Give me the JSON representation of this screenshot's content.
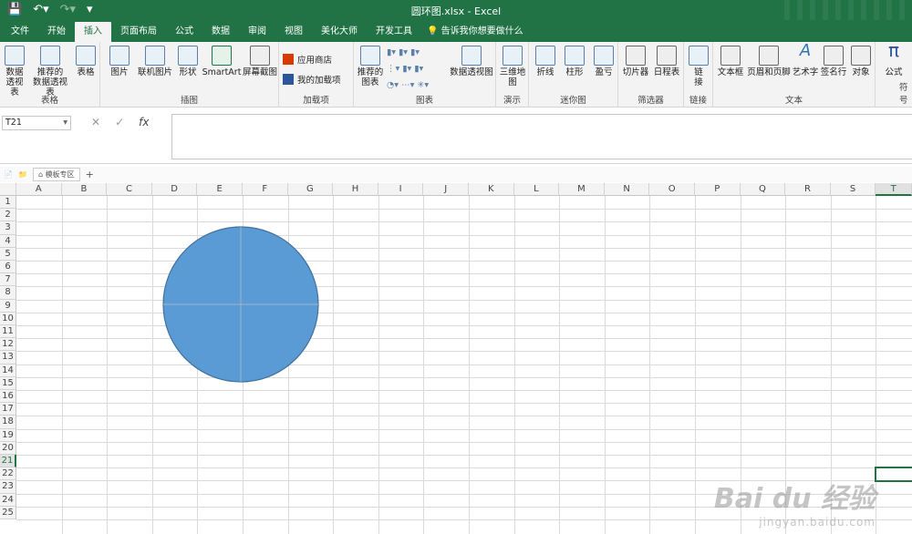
{
  "window": {
    "title": "圆环图.xlsx  -  Excel"
  },
  "qat": {
    "save_icon": "save-icon",
    "undo_icon": "undo-icon",
    "redo_icon": "redo-icon"
  },
  "tabs": [
    {
      "label": "文件"
    },
    {
      "label": "开始"
    },
    {
      "label": "插入"
    },
    {
      "label": "页面布局"
    },
    {
      "label": "公式"
    },
    {
      "label": "数据"
    },
    {
      "label": "审阅"
    },
    {
      "label": "视图"
    },
    {
      "label": "美化大师"
    },
    {
      "label": "开发工具"
    }
  ],
  "active_tab": "插入",
  "tell_me": "告诉我你想要做什么",
  "ribbon": {
    "groups": {
      "tables": "表格",
      "illustrations": "插图",
      "addins": "加载项",
      "charts": "图表",
      "tours": "演示",
      "sparklines": "迷你图",
      "filters": "筛选器",
      "links": "链接",
      "text": "文本",
      "symbols": "符号"
    },
    "buttons": {
      "pivot": "数据\n透视表",
      "recommended_pivot": "推荐的\n数据透视表",
      "table": "表格",
      "picture": "图片",
      "online_picture": "联机图片",
      "shapes": "形状",
      "smartart": "SmartArt",
      "screenshot": "屏幕截图",
      "store": "应用商店",
      "my_addins": "我的加载项",
      "recommended_charts": "推荐的\n图表",
      "pivot_chart": "数据透视图",
      "map3d": "三维地\n图",
      "line": "折线",
      "column": "柱形",
      "winloss": "盈亏",
      "slicer": "切片器",
      "timeline": "日程表",
      "hyperlink": "链\n接",
      "textbox": "文本框",
      "header_footer": "页眉和页脚",
      "wordart": "艺术字",
      "signature": "签名行",
      "object": "对象",
      "equation": "公式"
    }
  },
  "formula_bar": {
    "name_box": "T21",
    "fx": "fx",
    "value": ""
  },
  "sheet_tab": "模板专区",
  "columns": [
    "A",
    "B",
    "C",
    "D",
    "E",
    "F",
    "G",
    "H",
    "I",
    "J",
    "K",
    "L",
    "M",
    "N",
    "O",
    "P",
    "Q",
    "R",
    "S",
    "T"
  ],
  "rows": [
    "1",
    "2",
    "3",
    "4",
    "5",
    "6",
    "7",
    "8",
    "9",
    "10",
    "11",
    "12",
    "13",
    "14",
    "15",
    "16",
    "17",
    "18",
    "19",
    "20",
    "21",
    "22",
    "23",
    "24",
    "25"
  ],
  "selected_cell": "T21",
  "shape": {
    "kind": "circle",
    "fill": "#5b9bd5",
    "stroke": "#41719c"
  },
  "watermark": {
    "line1": "Bai du 经验",
    "line2": "jingyan.baidu.com"
  },
  "colors": {
    "brand": "#217346",
    "circle": "#5b9bd5"
  }
}
